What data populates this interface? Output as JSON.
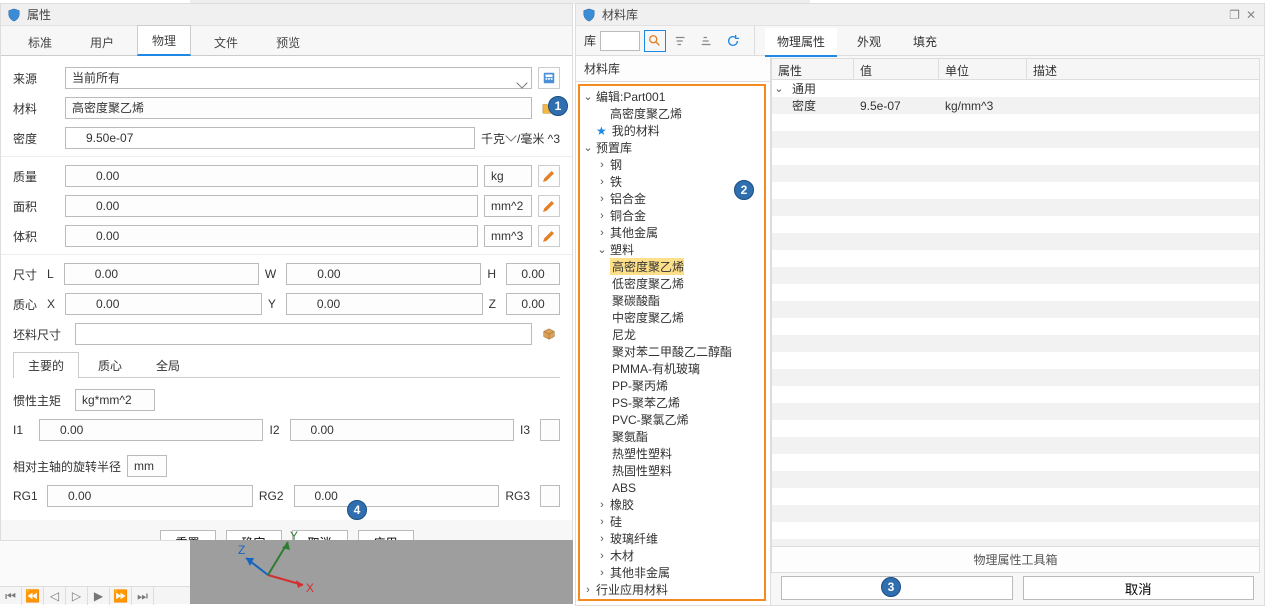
{
  "left": {
    "title": "属性",
    "tabs": [
      "标准",
      "用户",
      "物理",
      "文件",
      "预览"
    ],
    "active_tab": 2,
    "source": {
      "label": "来源",
      "value": "当前所有"
    },
    "material": {
      "label": "材料",
      "value": "高密度聚乙烯"
    },
    "density": {
      "label": "密度",
      "value": "9.50e-07",
      "unit1": "千克",
      "unit2": "/毫米 ^3"
    },
    "mass": {
      "label": "质量",
      "value": "0.00",
      "unit": "kg"
    },
    "area": {
      "label": "面积",
      "value": "0.00",
      "unit": "mm^2"
    },
    "volume": {
      "label": "体积",
      "value": "0.00",
      "unit": "mm^3"
    },
    "size": {
      "label": "尺寸",
      "l_label": "L",
      "l": "0.00",
      "w_label": "W",
      "w": "0.00",
      "h_label": "H",
      "h": "0.00"
    },
    "centroid": {
      "label": "质心",
      "x_label": "X",
      "x": "0.00",
      "y_label": "Y",
      "y": "0.00",
      "z_label": "Z",
      "z": "0.00"
    },
    "stock": {
      "label": "坯料尺寸"
    },
    "subtabs": [
      "主要的",
      "质心",
      "全局"
    ],
    "active_subtab": 0,
    "moment": {
      "label": "惯性主矩",
      "unit": "kg*mm^2"
    },
    "ixx": {
      "l1": "I1",
      "v1": "0.00",
      "l2": "I2",
      "v2": "0.00",
      "l3": "I3",
      "v3": ""
    },
    "radius": {
      "label": "相对主轴的旋转半径",
      "unit": "mm"
    },
    "rg": {
      "l1": "RG1",
      "v1": "0.00",
      "l2": "RG2",
      "v2": "0.00",
      "l3": "RG3",
      "v3": ""
    },
    "buttons": {
      "reset": "重置",
      "ok": "确定",
      "cancel": "取消",
      "apply": "应用"
    }
  },
  "right": {
    "title": "材料库",
    "lib_label": "库",
    "tabs": [
      "物理属性",
      "外观",
      "填充"
    ],
    "active_tab": 0,
    "tree_head": "材料库",
    "tree": {
      "edit": "编辑:Part001",
      "edit_child": "高密度聚乙烯",
      "mymat": "我的材料",
      "preset": "预置库",
      "steel": "钢",
      "iron": "铁",
      "al": "铝合金",
      "cu": "铜合金",
      "othermetal": "其他金属",
      "plastic": "塑料",
      "plastics": [
        "高密度聚乙烯",
        "低密度聚乙烯",
        "聚碳酸酯",
        "中密度聚乙烯",
        "尼龙",
        "聚对苯二甲酸乙二醇酯",
        "PMMA-有机玻璃",
        "PP-聚丙烯",
        "PS-聚苯乙烯",
        "PVC-聚氯乙烯",
        "聚氨酯",
        "热塑性塑料",
        "热固性塑料",
        "ABS"
      ],
      "rubber": "橡胶",
      "si": "硅",
      "fiber": "玻璃纤维",
      "wood": "木材",
      "nonmetal": "其他非金属",
      "industry": "行业应用材料"
    },
    "grid": {
      "headers": [
        "属性",
        "值",
        "单位",
        "描述"
      ],
      "group": "通用",
      "row": {
        "name": "密度",
        "value": "9.5e-07",
        "unit": "kg/mm^3",
        "desc": ""
      },
      "footer": "物理属性工具箱"
    },
    "buttons": {
      "blank": "",
      "cancel": "取消"
    }
  },
  "badges": {
    "b1": "1",
    "b2": "2",
    "b3": "3",
    "b4": "4"
  }
}
